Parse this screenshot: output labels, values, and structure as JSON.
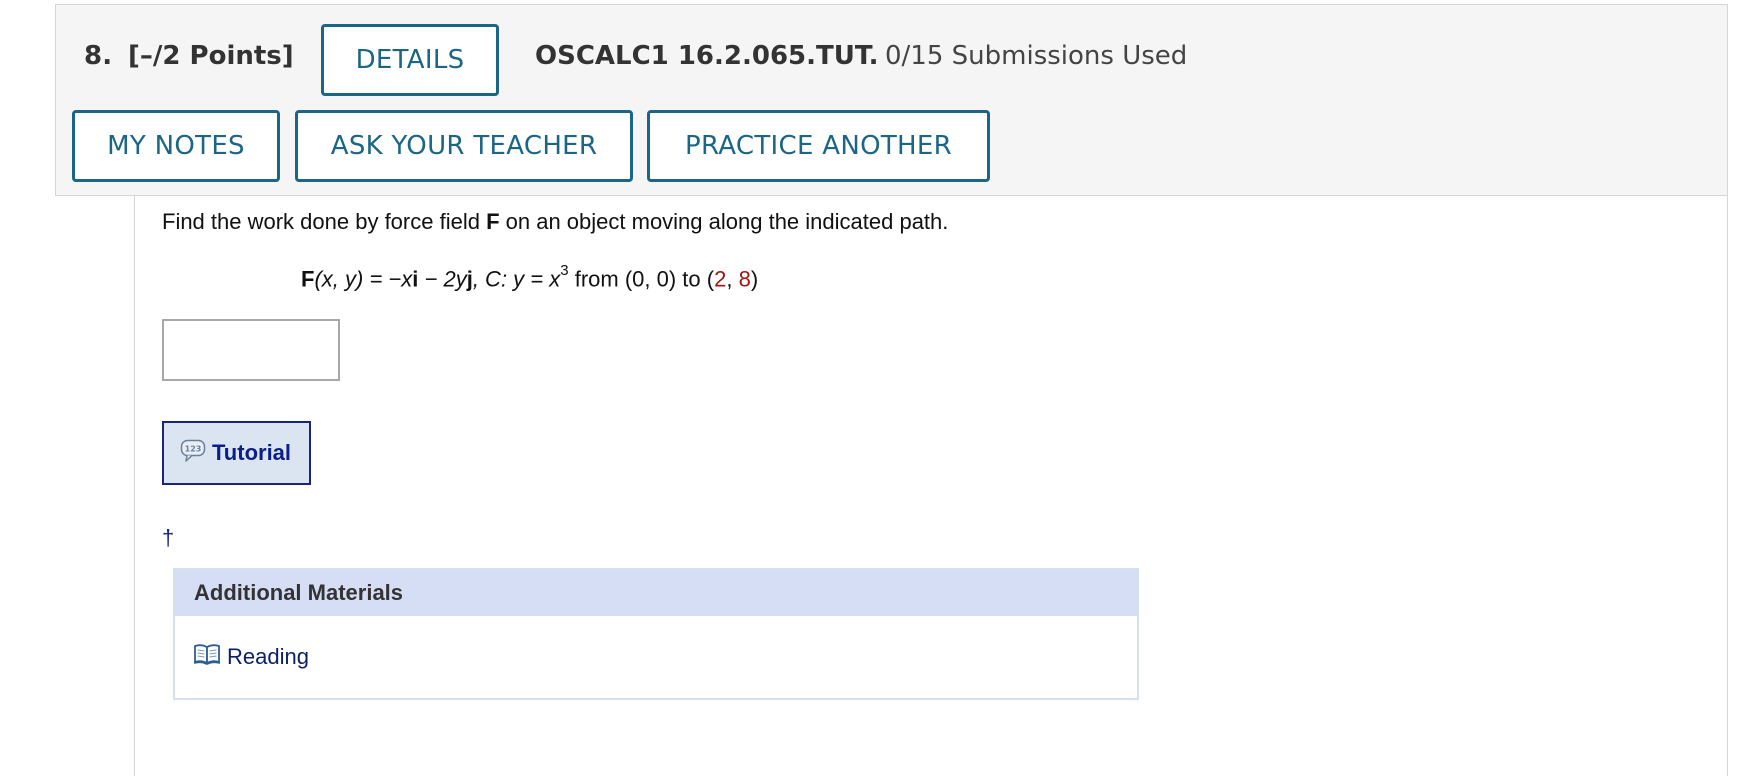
{
  "question": {
    "number": "8.",
    "points": "[–/2 Points]",
    "details_label": "DETAILS",
    "course_code": "OSCALC1 16.2.065.TUT.",
    "submissions": "0/15 Submissions Used"
  },
  "actions": {
    "my_notes": "MY NOTES",
    "ask_teacher": "ASK YOUR TEACHER",
    "practice_another": "PRACTICE ANOTHER"
  },
  "problem": {
    "prompt_before": "Find the work done by force field ",
    "prompt_bold": "F",
    "prompt_after": " on an object moving along the indicated path.",
    "formula": {
      "F": "F",
      "args": "(x, y)",
      "equals": " = −x",
      "i": "i",
      "minus": " − 2y",
      "j": "j",
      "curve": ", C: y = x",
      "exponent": "3",
      "from": " from (0, 0) to (",
      "end_x": "2",
      "comma": ", ",
      "end_y": "8",
      "close": ")"
    },
    "answer_value": ""
  },
  "tutorial": {
    "label": "Tutorial",
    "icon": "tutorial-calculator-bubble-icon"
  },
  "footnote": "†",
  "additional_materials": {
    "header": "Additional Materials",
    "items": [
      {
        "label": "Reading",
        "icon": "book-icon"
      }
    ]
  },
  "colors": {
    "button_border": "#1b6586",
    "header_bg": "#f5f5f5",
    "highlight_red": "#a31515",
    "tutorial_bg": "#dbe5f1",
    "materials_header_bg": "#d6def6"
  }
}
